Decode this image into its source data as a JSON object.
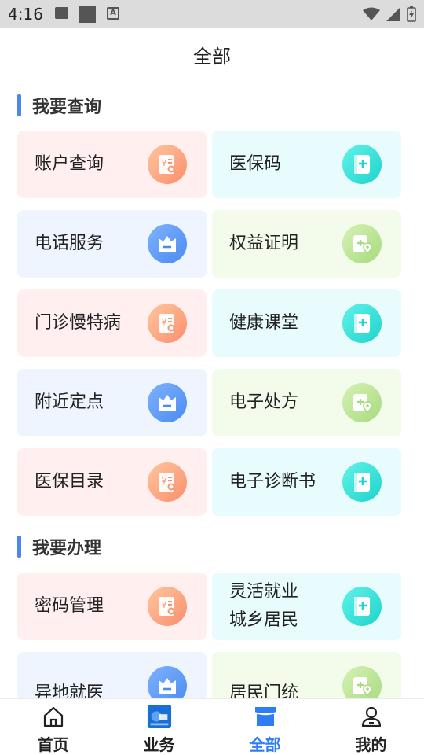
{
  "status_bar": {
    "time": "4:16"
  },
  "page_title": "全部",
  "sections": [
    {
      "title": "我要查询"
    },
    {
      "title": "我要办理"
    }
  ],
  "cards": [
    {
      "label": "账户查询"
    },
    {
      "label": "医保码"
    },
    {
      "label": "电话服务"
    },
    {
      "label": "权益证明"
    },
    {
      "label": "门诊慢特病"
    },
    {
      "label": "健康课堂"
    },
    {
      "label": "附近定点"
    },
    {
      "label": "电子处方"
    },
    {
      "label": "医保目录"
    },
    {
      "label": "电子诊断书"
    },
    {
      "label": "密码管理"
    },
    {
      "label_line1": "灵活就业",
      "label_line2": "城乡居民"
    },
    {
      "label": "异地就医"
    },
    {
      "label": "居民门统"
    }
  ],
  "colors": {
    "accent": "#2e7cf6",
    "section_bar": "#4b86f2"
  },
  "nav": [
    {
      "label": "首页",
      "icon": "home-icon"
    },
    {
      "label": "业务",
      "icon": "business-app-icon"
    },
    {
      "label": "全部",
      "icon": "shop-icon",
      "active": true
    },
    {
      "label": "我的",
      "icon": "user-icon"
    }
  ]
}
